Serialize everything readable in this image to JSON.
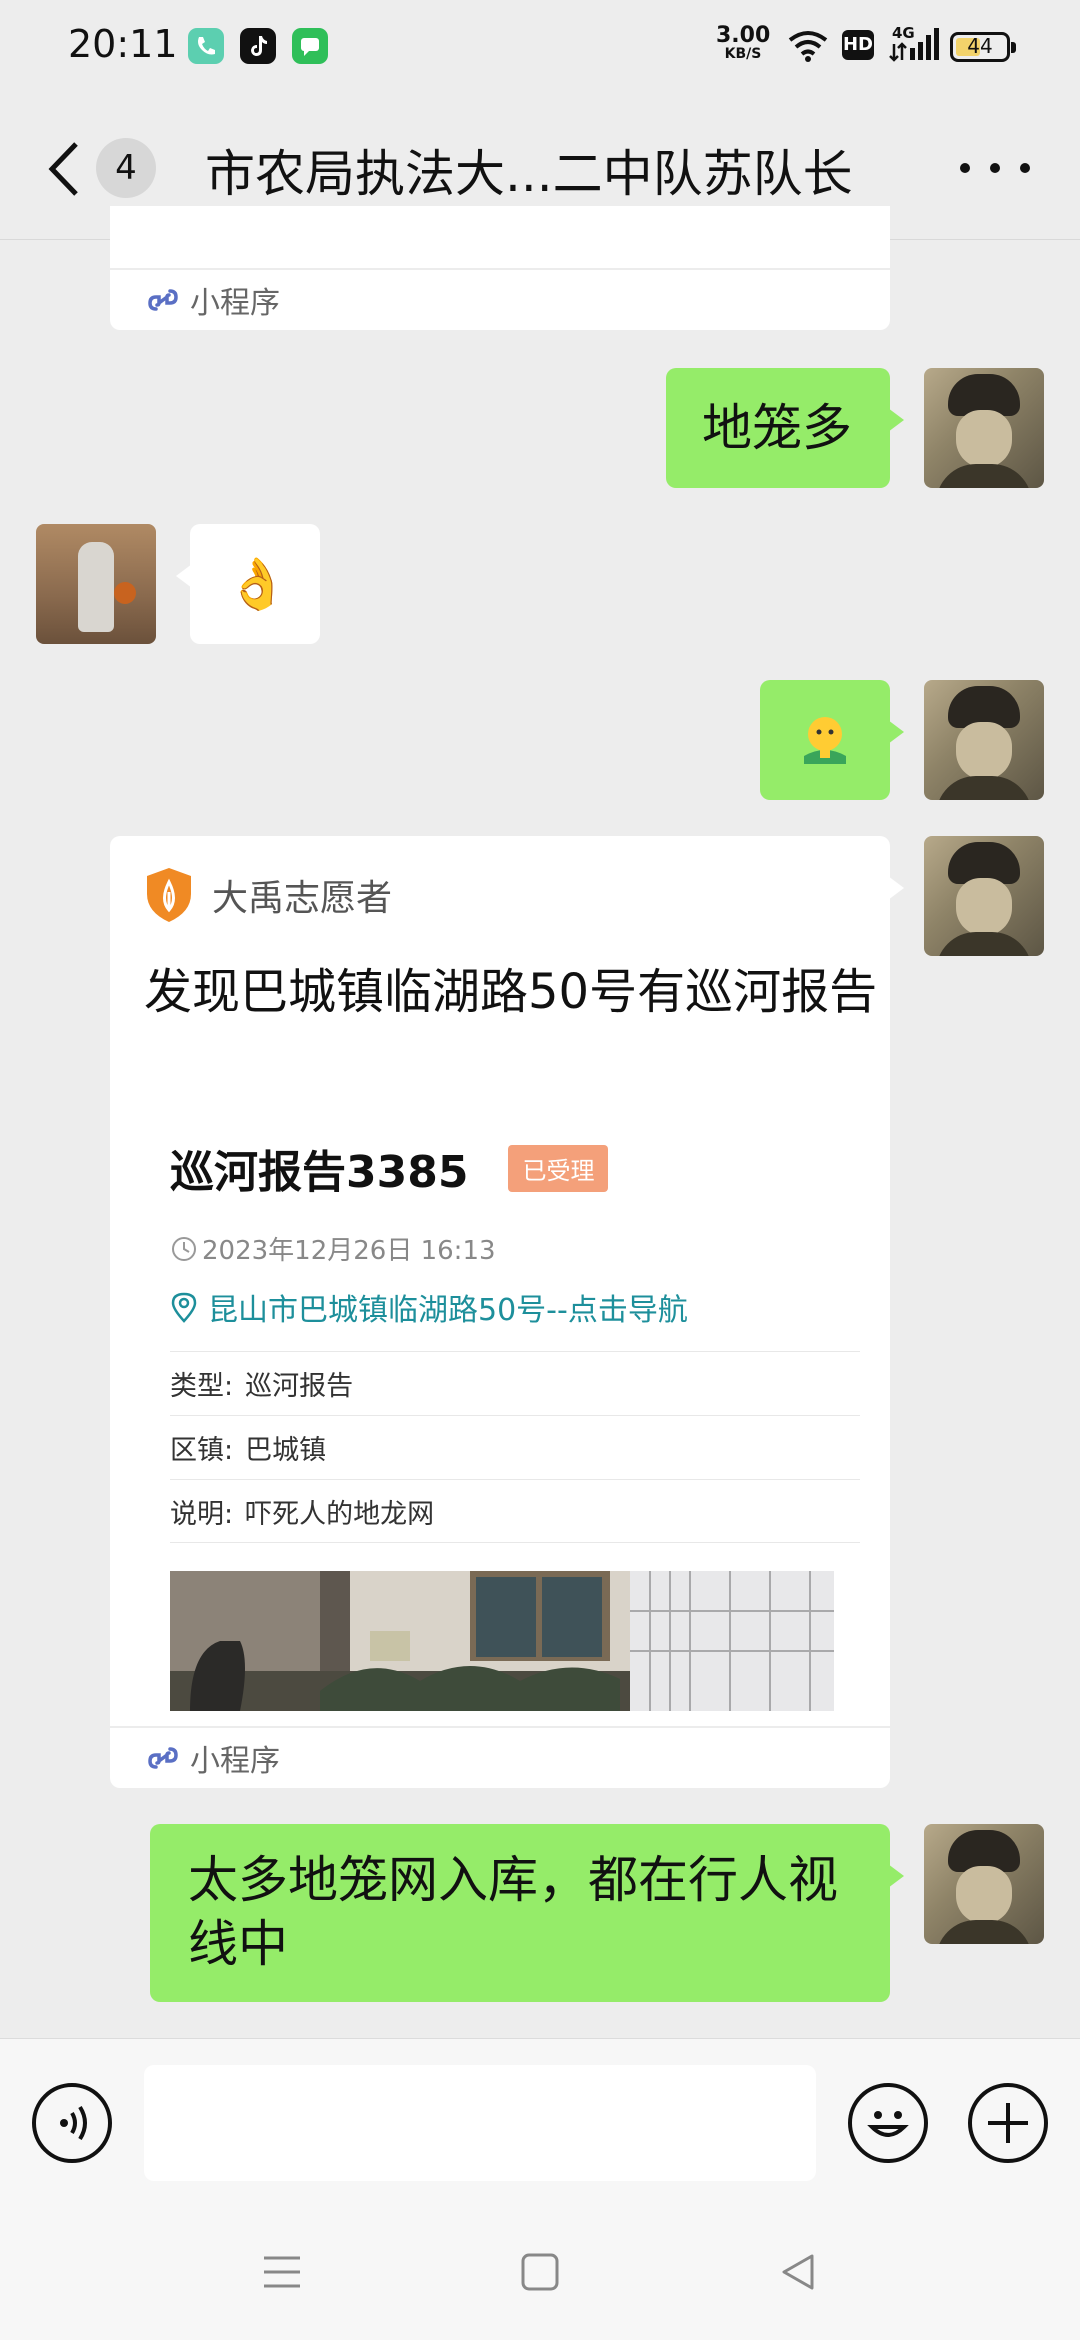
{
  "status_bar": {
    "time": "20:11",
    "speed_value": "3.00",
    "speed_unit": "KB/S",
    "hd_label": "HD",
    "network_label": "4G",
    "battery_level": "44",
    "icons": [
      "phone-app-icon",
      "tiktok-app-icon",
      "messages-app-icon",
      "wifi-icon",
      "signal-icon",
      "battery-icon"
    ]
  },
  "header": {
    "unread_count": "4",
    "title": "市农局执法大...二中队苏队长"
  },
  "messages": {
    "top_card_footer": "小程序",
    "msg1": "地笼多",
    "msg2_emoji": "👌",
    "msg3_emoji": "🫠",
    "card": {
      "source": "大禹志愿者",
      "title": "发现巴城镇临湖路50号有巡河报告",
      "report_id": "巡河报告3385",
      "status": "已受理",
      "time": "2023年12月26日 16:13",
      "location": "昆山市巴城镇临湖路50号--点击导航",
      "rows": [
        {
          "label": "类型:",
          "value": "巡河报告"
        },
        {
          "label": "区镇:",
          "value": "巴城镇"
        },
        {
          "label": "说明:",
          "value": "吓死人的地龙网"
        }
      ],
      "footer": "小程序"
    },
    "msg4": "太多地笼网入库，都在行人视线中"
  },
  "colors": {
    "sent_bubble": "#95ec69",
    "received_bubble": "#ffffff",
    "background": "#ededed",
    "link": "#1d8f9b",
    "status_tag": "#f4a07a"
  }
}
